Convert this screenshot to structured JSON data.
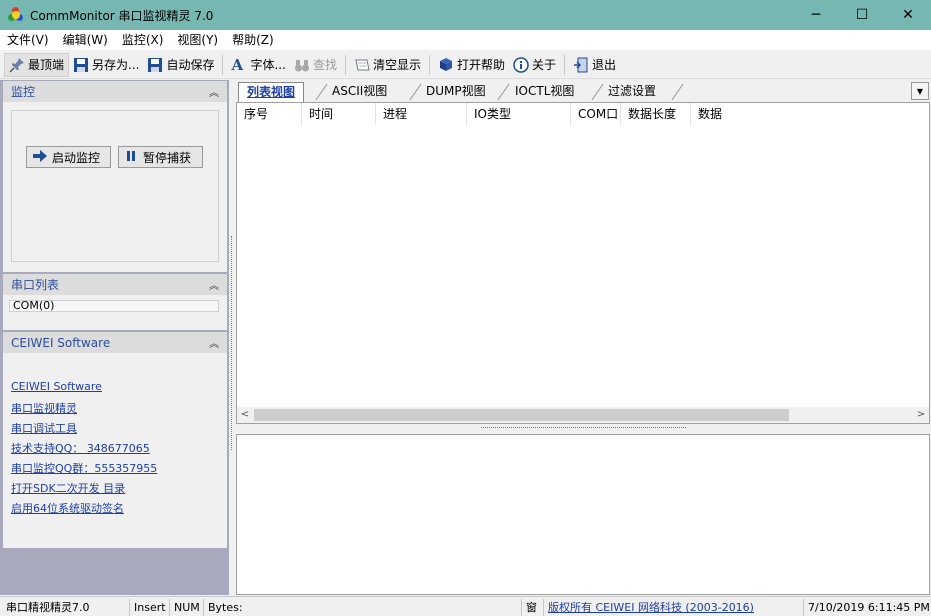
{
  "window": {
    "title": "CommMonitor 串口监视精灵 7.0",
    "minimize": "─",
    "maximize": "☐",
    "close": "✕"
  },
  "menu": [
    "文件(V)",
    "编辑(W)",
    "监控(X)",
    "视图(Y)",
    "帮助(Z)"
  ],
  "toolbar": {
    "topmost": "最顶端",
    "save_as": "另存为...",
    "auto_save": "自动保存",
    "font": "字体...",
    "find": "查找",
    "clear": "清空显示",
    "open_help": "打开帮助",
    "about": "关于",
    "exit": "退出"
  },
  "left": {
    "monitor_title": "监控",
    "start_btn": "启动监控",
    "pause_btn": "暂停捕获",
    "ports_title": "串口列表",
    "port_item": "COM(0)",
    "company_title": "CEIWEI Software",
    "links": [
      "CEIWEI Software",
      "串口监视精灵",
      "串口调试工具",
      "技术支持QQ：  348677065",
      "串口监控QQ群：555357955",
      "打开SDK二次开发 目录",
      "启用64位系统驱动签名"
    ]
  },
  "tabs": [
    "列表视图",
    "ASCII视图",
    "DUMP视图",
    "IOCTL视图",
    "过滤设置"
  ],
  "columns": [
    "序号",
    "时间",
    "进程",
    "IO类型",
    "COM口",
    "数据长度",
    "数据"
  ],
  "status": {
    "app": "串口精视精灵7.0",
    "insert": "Insert",
    "num": "NUM",
    "bytes": "Bytes:",
    "win": "窗",
    "copyright": "版权所有  CEIWEI 网络科技 (2003-2016)",
    "datetime": "7/10/2019 6:11:45 PM"
  },
  "colors": {
    "titlebar": "#77b7b2",
    "link": "#1d3fa8",
    "left_bg": "#a9a9bd"
  }
}
